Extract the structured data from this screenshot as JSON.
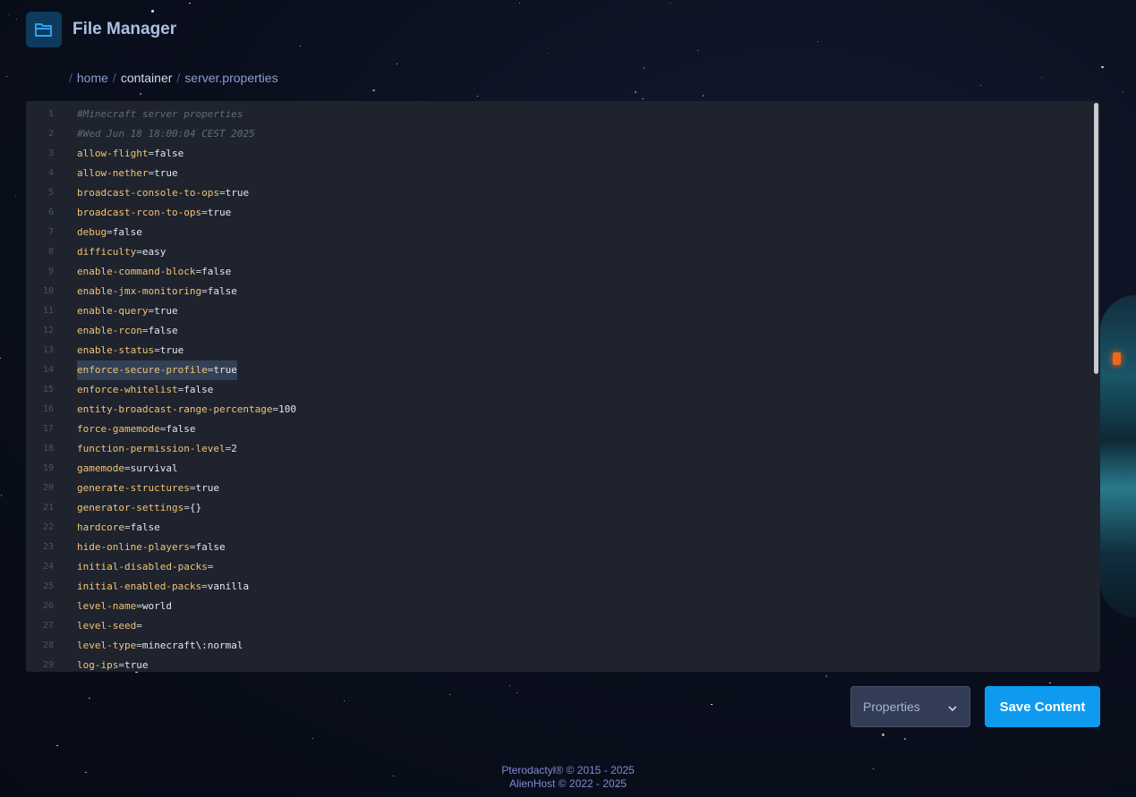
{
  "header": {
    "icon": "folder-open-icon",
    "title": "File Manager"
  },
  "breadcrumb": {
    "separator": "/",
    "items": [
      "home",
      "container"
    ],
    "current": "server.properties"
  },
  "editor": {
    "selected_line": 14,
    "lines": [
      {
        "n": "1",
        "comment": "#Minecraft server properties"
      },
      {
        "n": "2",
        "comment": "#Wed Jun 18 18:00:04 CEST 2025"
      },
      {
        "n": "3",
        "key": "allow-flight",
        "value": "false"
      },
      {
        "n": "4",
        "key": "allow-nether",
        "value": "true"
      },
      {
        "n": "5",
        "key": "broadcast-console-to-ops",
        "value": "true"
      },
      {
        "n": "6",
        "key": "broadcast-rcon-to-ops",
        "value": "true"
      },
      {
        "n": "7",
        "key": "debug",
        "value": "false"
      },
      {
        "n": "8",
        "key": "difficulty",
        "value": "easy"
      },
      {
        "n": "9",
        "key": "enable-command-block",
        "value": "false"
      },
      {
        "n": "10",
        "key": "enable-jmx-monitoring",
        "value": "false"
      },
      {
        "n": "11",
        "key": "enable-query",
        "value": "true"
      },
      {
        "n": "12",
        "key": "enable-rcon",
        "value": "false"
      },
      {
        "n": "13",
        "key": "enable-status",
        "value": "true"
      },
      {
        "n": "14",
        "key": "enforce-secure-profile",
        "value": "true"
      },
      {
        "n": "15",
        "key": "enforce-whitelist",
        "value": "false"
      },
      {
        "n": "16",
        "key": "entity-broadcast-range-percentage",
        "value": "100"
      },
      {
        "n": "17",
        "key": "force-gamemode",
        "value": "false"
      },
      {
        "n": "18",
        "key": "function-permission-level",
        "value": "2"
      },
      {
        "n": "19",
        "key": "gamemode",
        "value": "survival"
      },
      {
        "n": "20",
        "key": "generate-structures",
        "value": "true"
      },
      {
        "n": "21",
        "key": "generator-settings",
        "value": "{}"
      },
      {
        "n": "22",
        "key": "hardcore",
        "value": "false"
      },
      {
        "n": "23",
        "key": "hide-online-players",
        "value": "false"
      },
      {
        "n": "24",
        "key": "initial-disabled-packs",
        "value": ""
      },
      {
        "n": "25",
        "key": "initial-enabled-packs",
        "value": "vanilla"
      },
      {
        "n": "26",
        "key": "level-name",
        "value": "world"
      },
      {
        "n": "27",
        "key": "level-seed",
        "value": ""
      },
      {
        "n": "28",
        "key": "level-type",
        "value": "minecraft\\:normal"
      },
      {
        "n": "29",
        "key": "log-ips",
        "value": "true"
      }
    ]
  },
  "controls": {
    "language_select": "Properties",
    "language_icon": "chevron-down-icon",
    "save_label": "Save Content"
  },
  "footer": {
    "line1": "Pterodactyl® © 2015 - 2025",
    "line2": "AlienHost © 2022 - 2025"
  },
  "colors": {
    "accent": "#0e9bef",
    "key": "#f2c374",
    "comment": "#626b7c",
    "editor_bg": "#1e232e"
  }
}
